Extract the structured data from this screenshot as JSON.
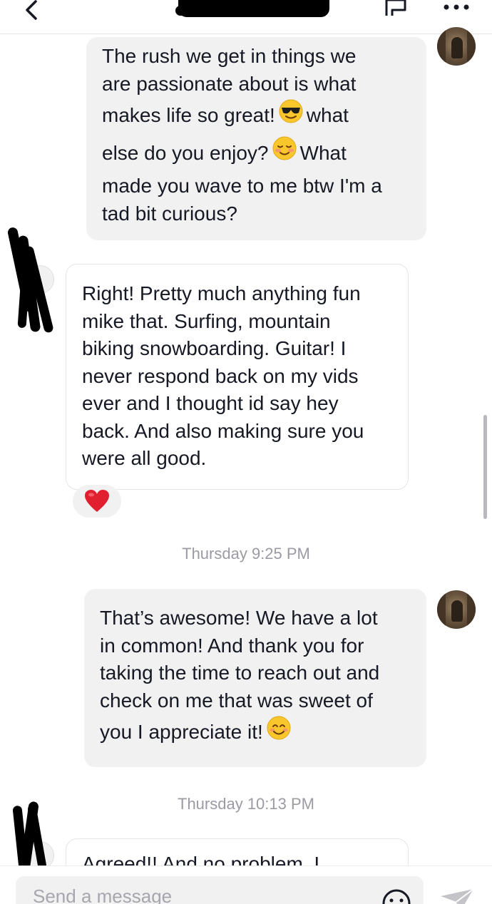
{
  "header": {
    "contact_name": "",
    "back_icon": "chevron-left-icon",
    "report_icon": "flag-icon",
    "more_icon": "more-horizontal-icon"
  },
  "messages": [
    {
      "sender": "me",
      "lines": [
        "The rush we get in things we",
        "are passionate about is what",
        "makes life so great!",
        "else do you enjoy?",
        "made you wave to me btw I'm a",
        "tad bit curious?"
      ],
      "inline": {
        "line3_after_emoji": "what",
        "line4_after_emoji": "What"
      },
      "emojis": [
        "smiling-face-with-sunglasses",
        "smiling-face-relieved"
      ]
    },
    {
      "sender": "them",
      "lines": [
        "Right! Pretty much anything fun",
        "mike that. Surfing, mountain",
        "biking snowboarding. Guitar! I",
        "never respond back on my vids",
        "ever and I thought id say hey",
        "back. And also making sure you",
        "were all good."
      ],
      "reaction": "red-heart"
    },
    {
      "sender": "me",
      "lines": [
        "That’s awesome! We have a lot",
        "in common! And thank you for",
        "taking the time to reach out and",
        "check on me that was sweet of",
        "you I appreciate it!"
      ],
      "emojis": [
        "smiling-face-with-smiling-eyes"
      ]
    },
    {
      "sender": "them",
      "lines": [
        "Agreed!! And no problem. I"
      ],
      "partial": true
    }
  ],
  "timestamps": [
    "Thursday 9:25 PM",
    "Thursday 10:13 PM"
  ],
  "composer": {
    "placeholder": "Send a message",
    "emoji_icon": "emoji-face-icon",
    "send_icon": "send-icon"
  },
  "colors": {
    "my_bubble": "#f1f1f2",
    "their_bubble_border": "#e5e5e8",
    "timestamp": "#9b9ba3",
    "heart": "#e0202e"
  }
}
